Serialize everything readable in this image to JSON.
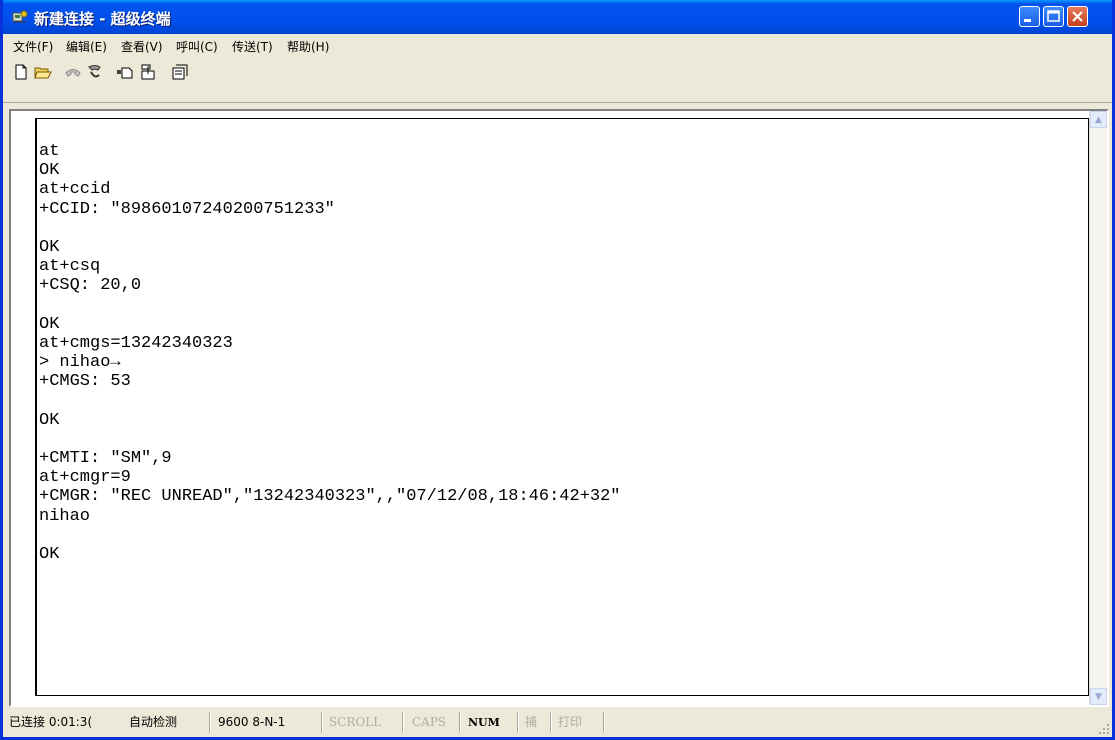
{
  "window": {
    "title": "新建连接 - 超级终端"
  },
  "menu": {
    "items": [
      "文件(F)",
      "编辑(E)",
      "查看(V)",
      "呼叫(C)",
      "传送(T)",
      "帮助(H)"
    ]
  },
  "toolbar": {
    "icons": [
      "new-icon",
      "open-icon",
      "call-icon",
      "disconnect-icon",
      "send-icon",
      "receive-icon",
      "properties-icon"
    ]
  },
  "terminal": {
    "lines": [
      "at",
      "OK",
      "at+ccid",
      "+CCID: \"89860107240200751233\"",
      "",
      "OK",
      "at+csq",
      "+CSQ: 20,0",
      "",
      "OK",
      "at+cmgs=13242340323",
      "> nihao→",
      "+CMGS: 53",
      "",
      "OK",
      "",
      "+CMTI: \"SM\",9",
      "at+cmgr=9",
      "+CMGR: \"REC UNREAD\",\"13242340323\",,\"07/12/08,18:46:42+32\"",
      "nihao",
      "",
      "OK"
    ]
  },
  "status": {
    "connected": "已连接 0:01:3(",
    "detect": "自动检测",
    "port": "9600 8-N-1",
    "scroll": "SCROLL",
    "caps": "CAPS",
    "num": "NUM",
    "capture": "捕",
    "print": "打印"
  },
  "colors": {
    "titlebar": "#0053ee",
    "window_border": "#0831d9",
    "chrome": "#ece9d8"
  }
}
